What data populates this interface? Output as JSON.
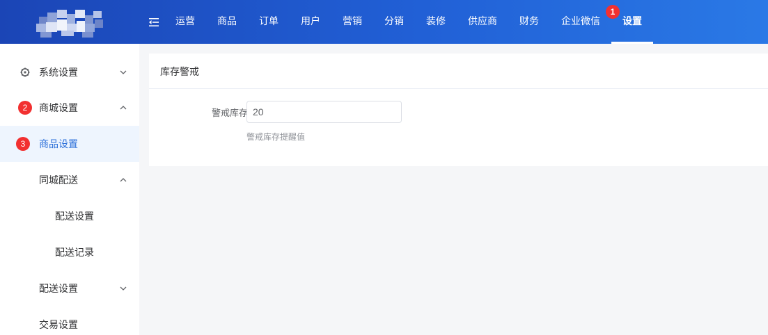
{
  "header": {
    "nav": [
      {
        "label": "运营"
      },
      {
        "label": "商品"
      },
      {
        "label": "订单"
      },
      {
        "label": "用户"
      },
      {
        "label": "营销"
      },
      {
        "label": "分销"
      },
      {
        "label": "装修"
      },
      {
        "label": "供应商"
      },
      {
        "label": "财务"
      },
      {
        "label": "企业微信"
      },
      {
        "label": "设置",
        "active": true,
        "badge": "1"
      }
    ]
  },
  "sidebar": {
    "items": [
      {
        "label": "系统设置",
        "icon": "gear-icon",
        "expanded": false
      },
      {
        "label": "商城设置",
        "badge": "2",
        "expanded": true
      },
      {
        "label": "商品设置",
        "badge": "3",
        "active": true
      },
      {
        "label": "同城配送",
        "expanded": true
      },
      {
        "label": "配送设置"
      },
      {
        "label": "配送记录"
      },
      {
        "label": "配送设置",
        "expanded": false
      },
      {
        "label": "交易设置"
      }
    ]
  },
  "content": {
    "title": "库存警戒",
    "field_label": "警戒库存",
    "field_value": "20",
    "field_hint": "警戒库存提醒值"
  },
  "colors": {
    "header_start": "#1b45b6",
    "header_end": "#2a79e6",
    "accent": "#2b6fd9",
    "badge": "#f23030",
    "active_bg": "#eef5fe"
  }
}
